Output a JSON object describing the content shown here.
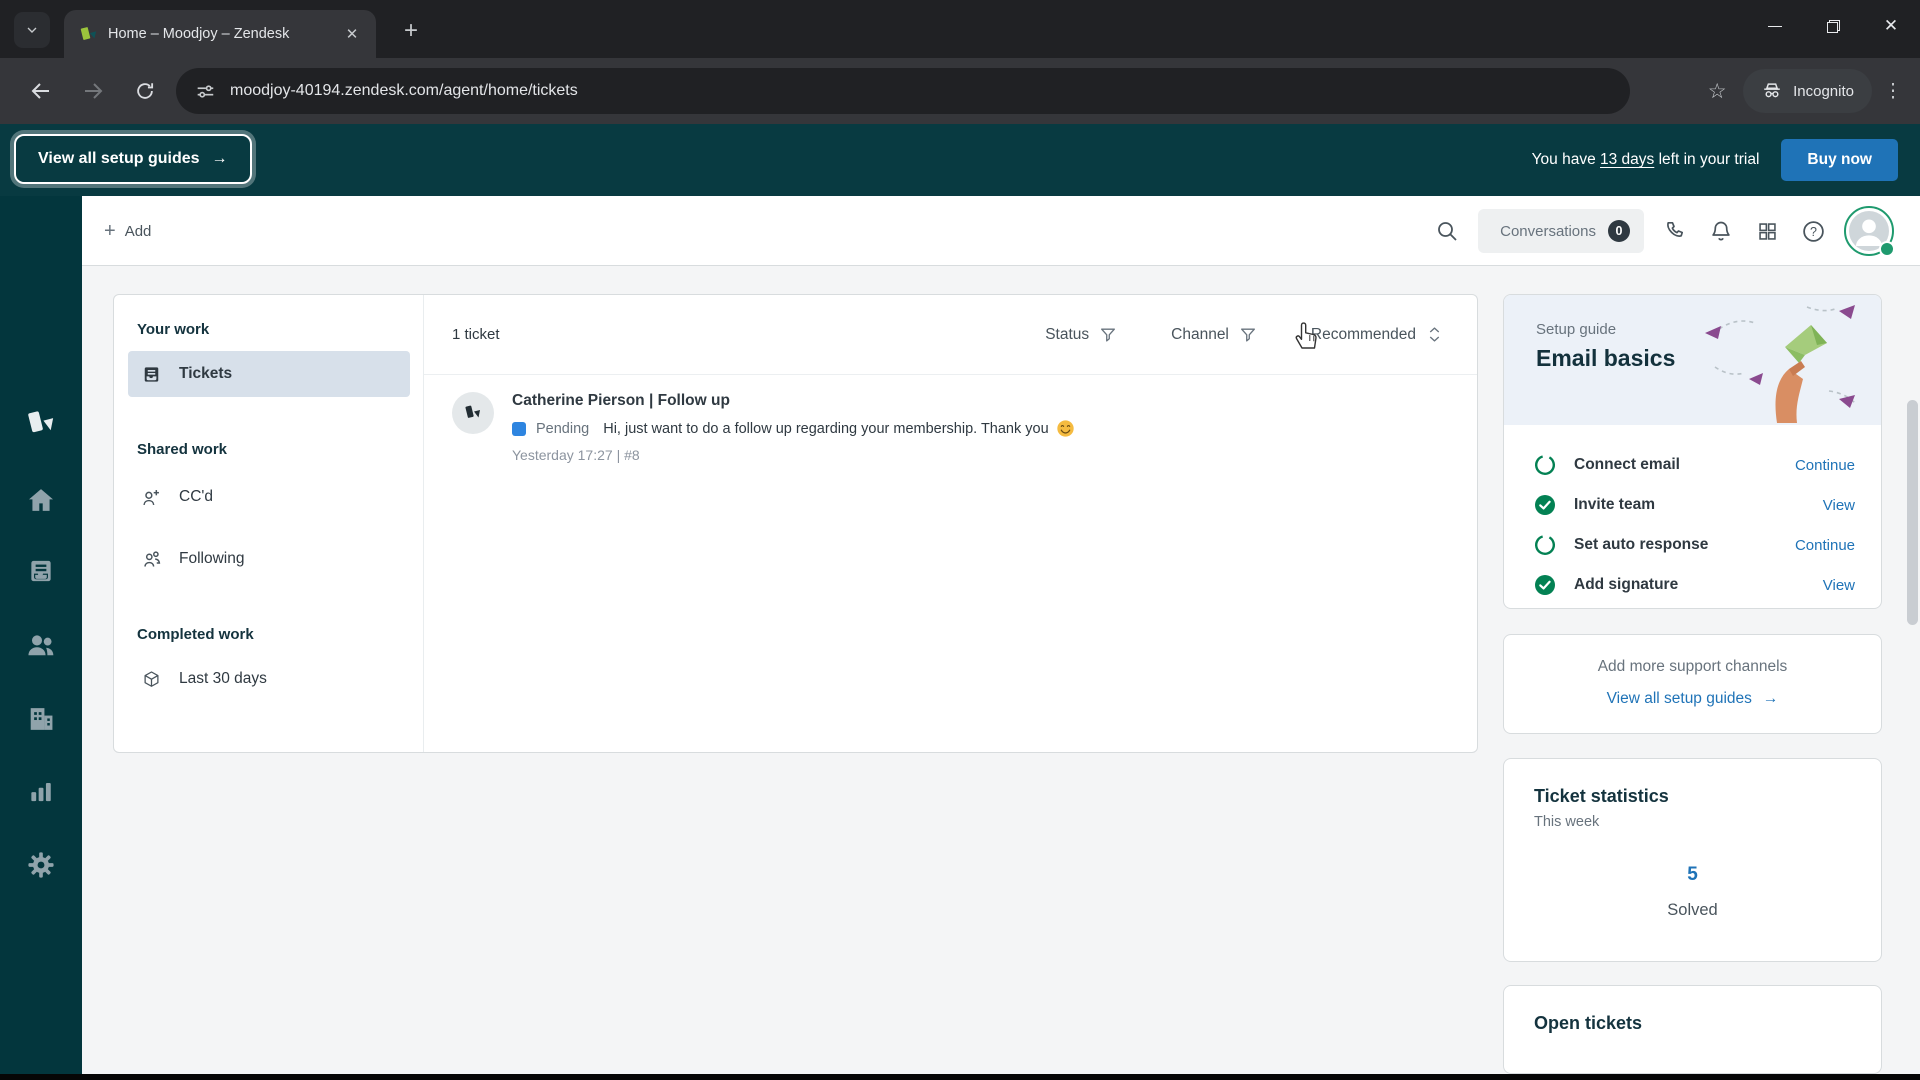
{
  "icons": {
    "plus": "+",
    "close": "✕",
    "star": "☆",
    "dots": "⋮",
    "minimize": "–",
    "arrow_right": "→",
    "pipe": "|"
  },
  "browser": {
    "tab_title": "Home – Moodjoy – Zendesk",
    "url": "moodjoy-40194.zendesk.com/agent/home/tickets",
    "incognito_label": "Incognito"
  },
  "banner": {
    "setup_guides_button": "View all setup guides",
    "trial_prefix": "You have ",
    "trial_days": "13 days",
    "trial_suffix": " left in your trial",
    "buy_now": "Buy now"
  },
  "topbar": {
    "add_label": "Add",
    "conversations_label": "Conversations",
    "conversations_count": "0"
  },
  "rail_items": [
    "zendesk-logo",
    "home",
    "tickets",
    "customers",
    "organizations",
    "reporting",
    "admin"
  ],
  "workspace_nav": {
    "sections": [
      {
        "heading": "Your work",
        "items": [
          {
            "label": "Tickets",
            "selected": true
          }
        ]
      },
      {
        "heading": "Shared work",
        "items": [
          {
            "label": "CC'd"
          },
          {
            "label": "Following"
          }
        ]
      },
      {
        "heading": "Completed work",
        "items": [
          {
            "label": "Last 30 days"
          }
        ]
      }
    ]
  },
  "ticket_list": {
    "count": "1 ticket",
    "filters": [
      {
        "label": "Status"
      },
      {
        "label": "Channel"
      }
    ],
    "sort": {
      "label": "Recommended"
    },
    "tickets": [
      {
        "title": "Catherine Pierson | Follow up",
        "status": "Pending",
        "preview": "Hi, just want to do a follow up regarding your membership. Thank you",
        "meta": "Yesterday 17:27 | #8"
      }
    ]
  },
  "setup_guide": {
    "kicker": "Setup guide",
    "title": "Email basics",
    "tasks": [
      {
        "label": "Connect email",
        "action": "Continue",
        "done": false
      },
      {
        "label": "Invite team",
        "action": "View",
        "done": true
      },
      {
        "label": "Set auto response",
        "action": "Continue",
        "done": false
      },
      {
        "label": "Add signature",
        "action": "View",
        "done": true
      }
    ]
  },
  "support_channels": {
    "title": "Add more support channels",
    "link_label": "View all setup guides"
  },
  "ticket_statistics": {
    "title": "Ticket statistics",
    "subtitle": "This week",
    "value": "5",
    "value_label": "Solved"
  },
  "open_tickets": {
    "title": "Open tickets"
  },
  "colors": {
    "banner_teal": "#083a41",
    "rail_teal": "#03363d",
    "accent_blue": "#1f73b7",
    "pending_blue": "#2e85e0",
    "success_green": "#038153",
    "selected_nav": "#d7e0ea"
  }
}
